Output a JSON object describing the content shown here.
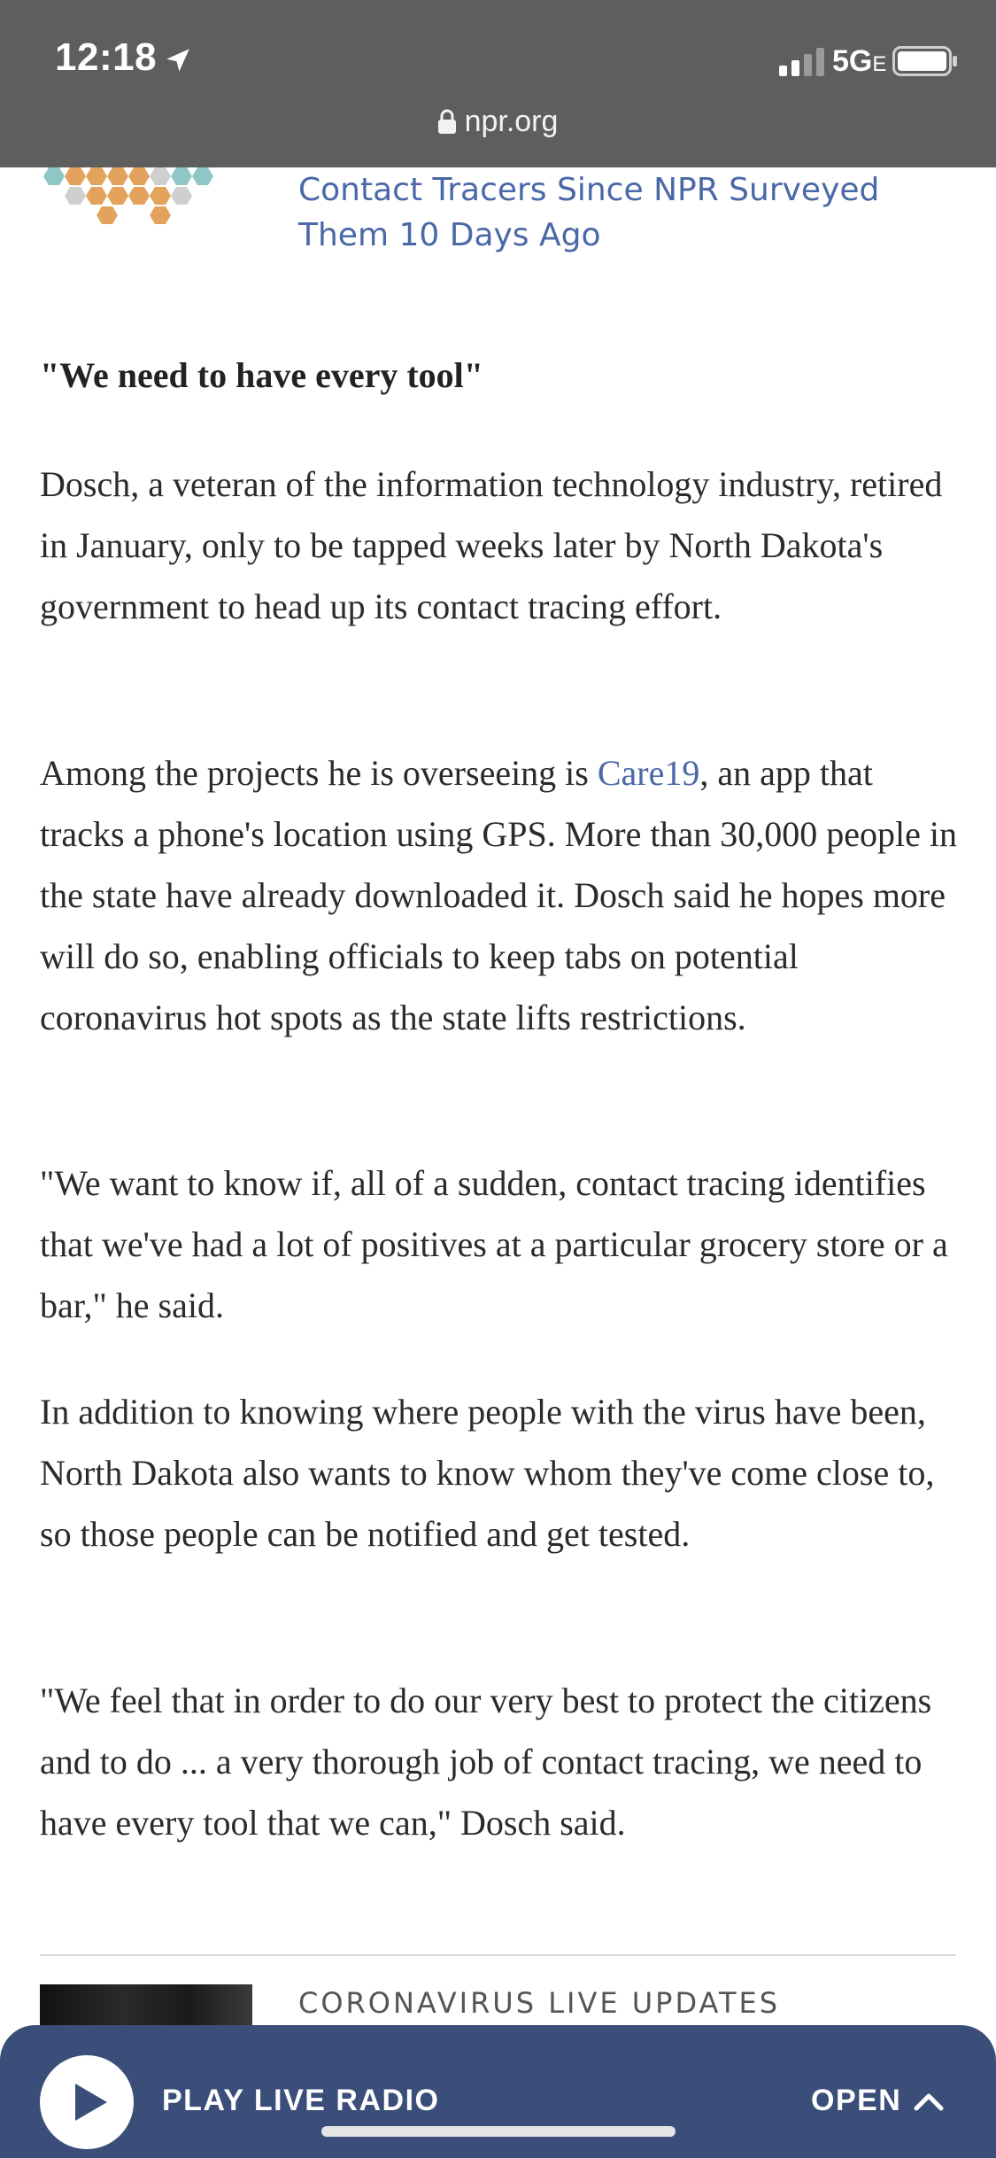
{
  "status_bar": {
    "time": "12:18",
    "network": "5G",
    "network_sub": "E"
  },
  "browser": {
    "url": "npr.org"
  },
  "related_story": {
    "title": "Contact Tracers Since NPR Surveyed Them 10 Days Ago"
  },
  "article": {
    "subhead": "\"We need to have every tool\"",
    "p1": "Dosch, a veteran of the information technology industry, retired in January, only to be tapped weeks later by North Dakota's government to head up its contact tracing effort.",
    "p2_before": "Among the projects he is overseeing is ",
    "p2_link": "Care19",
    "p2_after": ", an app that tracks a phone's location using GPS. More than 30,000 people in the state have already downloaded it. Dosch said he hopes more will do so, enabling officials to keep tabs on potential coronavirus hot spots as the state lifts restrictions.",
    "p3": "\"We want to know if, all of a sudden, contact tracing identifies that we've had a lot of positives at a particular grocery store or a bar,\" he said.",
    "p4": "In addition to knowing where people with the virus have been, North Dakota also wants to know whom they've come close to, so those people can be notified and get tested.",
    "p5": "\"We feel that in order to do our very best to protect the citizens and to do ... a very thorough job of contact tracing, we need to have every tool that we can,\" Dosch said."
  },
  "next_story": {
    "label": "CORONAVIRUS LIVE UPDATES"
  },
  "radio_bar": {
    "label": "PLAY LIVE RADIO",
    "open_label": "OPEN"
  },
  "colors": {
    "link": "#4a68a7",
    "radio_bar": "#3b4d79",
    "top_bar": "#5e5e5e"
  }
}
